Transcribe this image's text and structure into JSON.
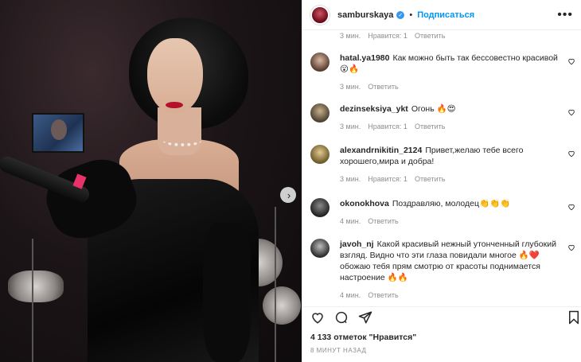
{
  "post": {
    "username": "samburskaya",
    "follow_label": "Подписаться",
    "separator": "•"
  },
  "top_meta": {
    "time": "3 мин.",
    "likes": "Нравится: 1",
    "reply": "Ответить"
  },
  "comments": [
    {
      "user": "hatal.ya1980",
      "text": "Как можно быть так бессовестно красивой😮🔥",
      "time": "3 мин.",
      "likes": "",
      "reply": "Ответить"
    },
    {
      "user": "dezinseksiya_ykt",
      "text": "Огонь 🔥😍",
      "time": "3 мин.",
      "likes": "Нравится: 1",
      "reply": "Ответить"
    },
    {
      "user": "alexandrnikitin_2124",
      "text": "Привет,желаю тебе всего хорошего,мира и добра!",
      "time": "3 мин.",
      "likes": "Нравится: 1",
      "reply": "Ответить"
    },
    {
      "user": "okonokhova",
      "text": "Поздравляю, молодец👏👏👏",
      "time": "4 мин.",
      "likes": "",
      "reply": "Ответить"
    },
    {
      "user": "javoh_nj",
      "text": "Какой красивый нежный утонченный глубокий взгляд. Видно что эти глаза повидали многое 🔥❤️обожаю тебя прям смотрю от красоты поднимается настроение 🔥🔥",
      "time": "4 мин.",
      "likes": "",
      "reply": "Ответить"
    }
  ],
  "footer": {
    "likes_count": "4 133 отметок \"Нравится\"",
    "posted": "8 МИНУТ НАЗАД"
  },
  "icons": {
    "verified": "verified-badge-icon",
    "more": "more-options-icon",
    "like": "heart-icon",
    "comment": "comment-bubble-icon",
    "share": "paper-plane-icon",
    "save": "bookmark-icon",
    "next": "chevron-right-icon"
  },
  "colors": {
    "accent": "#0095f6",
    "verified": "#3897f0",
    "muted": "#8e8e8e",
    "text": "#262626"
  }
}
